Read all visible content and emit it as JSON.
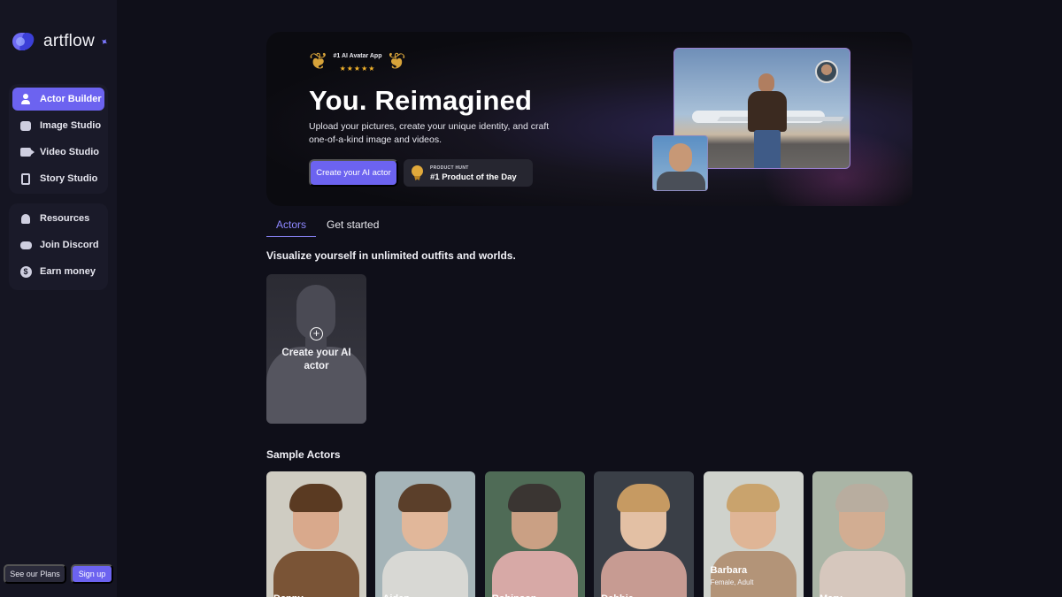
{
  "brand": {
    "name": "artflow"
  },
  "sidebar": {
    "main_items": [
      {
        "label": "Actor Builder",
        "icon": "user-icon",
        "active": true
      },
      {
        "label": "Image Studio",
        "icon": "image-icon"
      },
      {
        "label": "Video Studio",
        "icon": "video-icon"
      },
      {
        "label": "Story Studio",
        "icon": "story-icon"
      }
    ],
    "secondary_items": [
      {
        "label": "Resources",
        "icon": "bell-icon"
      },
      {
        "label": "Join Discord",
        "icon": "discord-icon"
      },
      {
        "label": "Earn money",
        "icon": "dollar-icon"
      }
    ],
    "plans_label": "See our Plans",
    "signup_label": "Sign up"
  },
  "hero": {
    "award_title": "#1 AI Avatar App",
    "award_stars": "★★★★★",
    "title": "You. Reimagined",
    "description": "Upload your pictures, create your unique identity, and craft one-of-a-kind image and videos.",
    "cta_label": "Create your AI actor",
    "badge_small": "PRODUCT HUNT",
    "badge_big": "#1 Product of the Day"
  },
  "tabs": [
    {
      "label": "Actors",
      "active": true
    },
    {
      "label": "Get started",
      "active": false
    }
  ],
  "section_visualize": "Visualize yourself in unlimited outfits and worlds.",
  "create_card_label": "Create your AI actor",
  "section_samples": "Sample Actors",
  "actors": [
    {
      "name": "Danny",
      "subtitle": "",
      "bg": "#cfccc2",
      "skin": "#d9a98c",
      "hair": "#5a3a22",
      "clothes": "#7a5436"
    },
    {
      "name": "Aiden",
      "subtitle": "",
      "bg": "#a5b4b8",
      "skin": "#e1b79a",
      "hair": "#5b3f2a",
      "clothes": "#d8d8d4"
    },
    {
      "name": "Robinson",
      "subtitle": "",
      "bg": "#4f6b56",
      "skin": "#caa084",
      "hair": "#3a3532",
      "clothes": "#d7a9a6"
    },
    {
      "name": "Debbie",
      "subtitle": "",
      "bg": "#3a3f47",
      "skin": "#e3c0a4",
      "hair": "#c69a62",
      "clothes": "#c79b92"
    },
    {
      "name": "Barbara",
      "subtitle": "Female, Adult",
      "bg": "#cfd2cc",
      "skin": "#dfb596",
      "hair": "#c9a36d",
      "clothes": "#b39478"
    },
    {
      "name": "Mary",
      "subtitle": "",
      "bg": "#aab5a6",
      "skin": "#d2ad92",
      "hair": "#b8ad9f",
      "clothes": "#d6c7bd"
    }
  ],
  "colors": {
    "accent": "#6c63f0",
    "background": "#0f0f19",
    "sidebar": "#151522"
  }
}
